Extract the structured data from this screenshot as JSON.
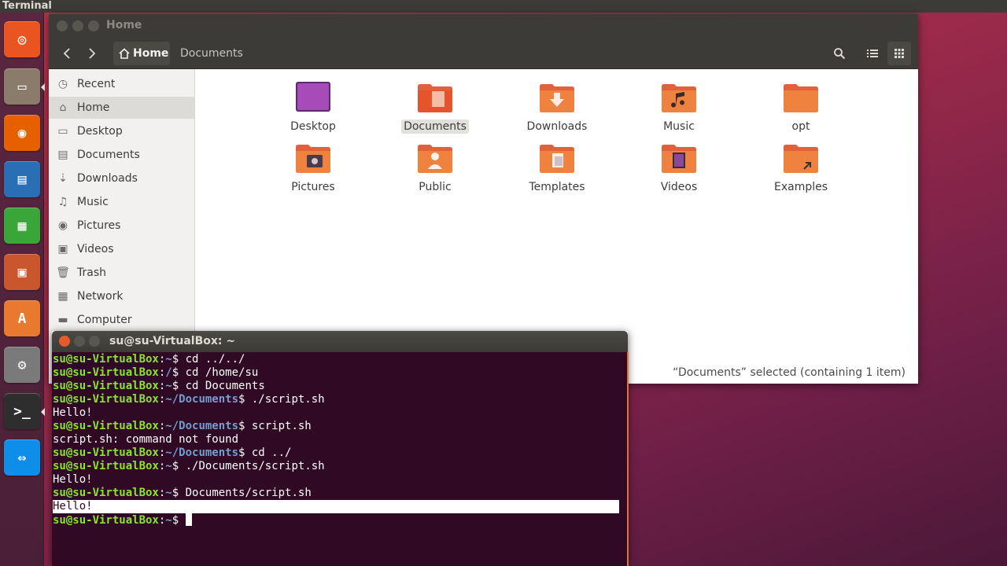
{
  "topbar": {
    "title": "Terminal"
  },
  "launcher": {
    "items": [
      {
        "name": "ubuntu-dash-icon",
        "color": "#e95420"
      },
      {
        "name": "files-icon",
        "color": "#8a7b6b"
      },
      {
        "name": "firefox-icon",
        "color": "#e66000"
      },
      {
        "name": "libreoffice-writer-icon",
        "color": "#2a6fb5"
      },
      {
        "name": "libreoffice-calc-icon",
        "color": "#3aa63a"
      },
      {
        "name": "libreoffice-impress-icon",
        "color": "#c9562d"
      },
      {
        "name": "software-center-icon",
        "color": "#e8792f"
      },
      {
        "name": "system-settings-icon",
        "color": "#7a7a7a"
      },
      {
        "name": "terminal-icon",
        "color": "#2e2e2e"
      },
      {
        "name": "teamviewer-icon",
        "color": "#0e8ee9"
      }
    ]
  },
  "files": {
    "window_title": "Home",
    "breadcrumb": {
      "home": "Home",
      "current": "Documents"
    },
    "sidebar": [
      {
        "label": "Recent",
        "icon": "clock-icon",
        "glyph": "◷"
      },
      {
        "label": "Home",
        "icon": "home-icon",
        "glyph": "⌂"
      },
      {
        "label": "Desktop",
        "icon": "desktop-icon",
        "glyph": "▭"
      },
      {
        "label": "Documents",
        "icon": "document-icon",
        "glyph": "▤"
      },
      {
        "label": "Downloads",
        "icon": "download-icon",
        "glyph": "⇣"
      },
      {
        "label": "Music",
        "icon": "music-icon",
        "glyph": "♫"
      },
      {
        "label": "Pictures",
        "icon": "camera-icon",
        "glyph": "◉"
      },
      {
        "label": "Videos",
        "icon": "video-icon",
        "glyph": "▣"
      },
      {
        "label": "Trash",
        "icon": "trash-icon",
        "glyph": "🗑"
      },
      {
        "label": "Network",
        "icon": "network-icon",
        "glyph": "▦"
      },
      {
        "label": "Computer",
        "icon": "computer-icon",
        "glyph": "▬"
      }
    ],
    "folders": [
      {
        "label": "Desktop",
        "type": "desktop"
      },
      {
        "label": "Documents",
        "type": "documents"
      },
      {
        "label": "Downloads",
        "type": "downloads"
      },
      {
        "label": "Music",
        "type": "music"
      },
      {
        "label": "opt",
        "type": "plain"
      },
      {
        "label": "Pictures",
        "type": "pictures"
      },
      {
        "label": "Public",
        "type": "public"
      },
      {
        "label": "Templates",
        "type": "templates"
      },
      {
        "label": "Videos",
        "type": "videos"
      },
      {
        "label": "Examples",
        "type": "examples"
      }
    ],
    "status": "“Documents” selected  (containing 1 item)"
  },
  "terminal": {
    "window_title": "su@su-VirtualBox: ~",
    "lines": [
      {
        "user": "su@su-VirtualBox",
        "path": "~",
        "cmd": " cd ../../"
      },
      {
        "user": "su@su-VirtualBox",
        "path": "/",
        "cmd": " cd /home/su"
      },
      {
        "user": "su@su-VirtualBox",
        "path": "~",
        "cmd": " cd Documents"
      },
      {
        "user": "su@su-VirtualBox",
        "path": "~/Documents",
        "cmd": " ./script.sh"
      },
      {
        "out": "Hello!"
      },
      {
        "user": "su@su-VirtualBox",
        "path": "~/Documents",
        "cmd": " script.sh"
      },
      {
        "out": "script.sh: command not found"
      },
      {
        "user": "su@su-VirtualBox",
        "path": "~/Documents",
        "cmd": " cd ../"
      },
      {
        "user": "su@su-VirtualBox",
        "path": "~",
        "cmd": " ./Documents/script.sh"
      },
      {
        "out": "Hello!"
      },
      {
        "user": "su@su-VirtualBox",
        "path": "~",
        "cmd": " Documents/script.sh"
      },
      {
        "out": "Hello!",
        "highlight": true
      },
      {
        "user": "su@su-VirtualBox",
        "path": "~",
        "cmd": " ",
        "cursor": true
      }
    ]
  }
}
